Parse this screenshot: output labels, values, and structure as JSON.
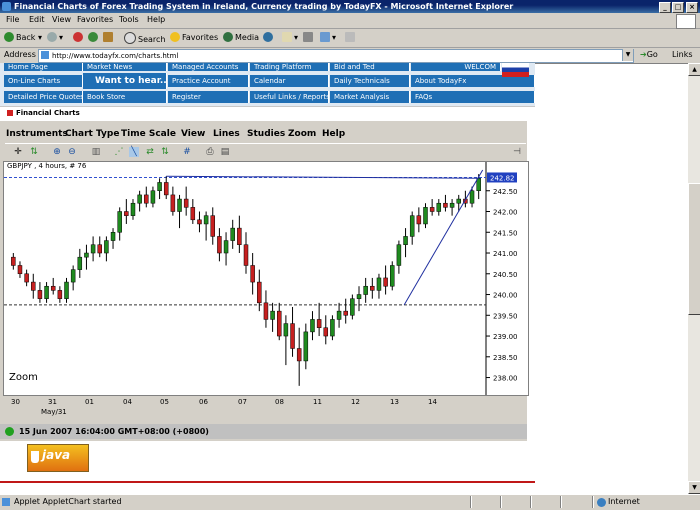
{
  "window": {
    "title": "Financial Charts of Forex Trading System in Ireland, Currency trading by TodayFX - Microsoft Internet Explorer"
  },
  "menubar": [
    "File",
    "Edit",
    "View",
    "Favorites",
    "Tools",
    "Help"
  ],
  "toolbar": {
    "back": "Back",
    "search": "Search",
    "favorites": "Favorites",
    "media": "Media"
  },
  "address": {
    "label": "Address",
    "url": "http://www.todayfx.com/charts.html",
    "go": "Go",
    "links": "Links"
  },
  "nav": {
    "row0": [
      "Home Page",
      "Market News",
      "Managed Accounts",
      "Trading Platform",
      "Bid and Ted",
      "WELCOM"
    ],
    "row1": [
      "On-Line Charts",
      "Want to hear..",
      "Practice Account",
      "Calendar",
      "Daily Technicals",
      "About TodayFx"
    ],
    "row2": [
      "Detailed Price Quotes",
      "Book Store",
      "Register",
      "Useful Links / Reports",
      "Market Analysis",
      "FAQs"
    ]
  },
  "section_title": "Financial Charts",
  "applet": {
    "menu": [
      "Instruments",
      "Chart Type",
      "Time Scale",
      "View",
      "Lines",
      "Studies",
      "Zoom",
      "Help"
    ],
    "symbol_label": "GBPJPY , 4 hours, # 76",
    "zoom_label": "Zoom",
    "status_text": "15 Jun 2007 16:04:00  GMT+08:00 (+0800)"
  },
  "chart_data": {
    "type": "candlestick",
    "symbol": "GBPJPY",
    "interval": "4 hours",
    "x_labels": [
      "30",
      "31",
      "01",
      "04",
      "05",
      "06",
      "07",
      "08",
      "11",
      "12",
      "13",
      "14"
    ],
    "x_sublabel": "May/31",
    "y_ticks": [
      238.0,
      238.5,
      239.0,
      239.5,
      240.0,
      240.5,
      241.0,
      241.5,
      242.0,
      242.5
    ],
    "ylim": [
      237.7,
      243.0
    ],
    "last_price_label": "242.82",
    "reference_lines": [
      242.82,
      239.75
    ],
    "candles": [
      [
        240.9,
        241.0,
        240.6,
        240.7
      ],
      [
        240.7,
        240.8,
        240.4,
        240.5
      ],
      [
        240.5,
        240.6,
        240.2,
        240.3
      ],
      [
        240.3,
        240.5,
        239.9,
        240.1
      ],
      [
        240.1,
        240.3,
        239.8,
        239.9
      ],
      [
        239.9,
        240.3,
        239.8,
        240.2
      ],
      [
        240.2,
        240.4,
        240.0,
        240.1
      ],
      [
        240.1,
        240.2,
        239.8,
        239.9
      ],
      [
        239.9,
        240.4,
        239.8,
        240.3
      ],
      [
        240.3,
        240.7,
        240.1,
        240.6
      ],
      [
        240.6,
        241.1,
        240.4,
        240.9
      ],
      [
        240.9,
        241.2,
        240.6,
        241.0
      ],
      [
        241.0,
        241.4,
        240.8,
        241.2
      ],
      [
        241.2,
        241.4,
        240.9,
        241.0
      ],
      [
        241.0,
        241.4,
        240.8,
        241.3
      ],
      [
        241.3,
        241.6,
        241.1,
        241.5
      ],
      [
        241.5,
        242.1,
        241.3,
        242.0
      ],
      [
        242.0,
        242.3,
        241.7,
        241.9
      ],
      [
        241.9,
        242.3,
        241.8,
        242.2
      ],
      [
        242.2,
        242.5,
        242.0,
        242.4
      ],
      [
        242.4,
        242.6,
        242.1,
        242.2
      ],
      [
        242.2,
        242.6,
        242.1,
        242.5
      ],
      [
        242.5,
        242.8,
        242.3,
        242.7
      ],
      [
        242.7,
        242.85,
        242.3,
        242.4
      ],
      [
        242.4,
        242.6,
        241.9,
        242.0
      ],
      [
        242.0,
        242.4,
        241.6,
        242.3
      ],
      [
        242.3,
        242.6,
        241.9,
        242.1
      ],
      [
        242.1,
        242.3,
        241.7,
        241.8
      ],
      [
        241.8,
        242.0,
        241.5,
        241.7
      ],
      [
        241.7,
        242.0,
        241.3,
        241.9
      ],
      [
        241.9,
        242.1,
        241.2,
        241.4
      ],
      [
        241.4,
        241.6,
        240.8,
        241.0
      ],
      [
        241.0,
        241.5,
        240.7,
        241.3
      ],
      [
        241.3,
        241.8,
        241.1,
        241.6
      ],
      [
        241.6,
        241.9,
        241.0,
        241.2
      ],
      [
        241.2,
        241.5,
        240.5,
        240.7
      ],
      [
        240.7,
        241.0,
        240.0,
        240.3
      ],
      [
        240.3,
        240.6,
        239.6,
        239.8
      ],
      [
        239.8,
        240.1,
        239.2,
        239.4
      ],
      [
        239.4,
        239.8,
        239.1,
        239.6
      ],
      [
        239.6,
        239.8,
        238.9,
        239.0
      ],
      [
        239.0,
        239.5,
        238.3,
        239.3
      ],
      [
        239.3,
        239.7,
        238.5,
        238.7
      ],
      [
        238.7,
        239.2,
        237.8,
        238.4
      ],
      [
        238.4,
        239.3,
        238.2,
        239.1
      ],
      [
        239.1,
        239.6,
        238.9,
        239.4
      ],
      [
        239.4,
        239.8,
        239.0,
        239.2
      ],
      [
        239.2,
        239.5,
        238.8,
        239.0
      ],
      [
        239.0,
        239.5,
        238.9,
        239.4
      ],
      [
        239.4,
        239.8,
        239.2,
        239.6
      ],
      [
        239.6,
        239.9,
        239.3,
        239.5
      ],
      [
        239.5,
        240.0,
        239.4,
        239.9
      ],
      [
        239.9,
        240.2,
        239.6,
        240.0
      ],
      [
        240.0,
        240.4,
        239.8,
        240.2
      ],
      [
        240.2,
        240.4,
        239.9,
        240.1
      ],
      [
        240.1,
        240.5,
        239.9,
        240.4
      ],
      [
        240.4,
        240.7,
        240.0,
        240.2
      ],
      [
        240.2,
        240.8,
        240.1,
        240.7
      ],
      [
        240.7,
        241.3,
        240.5,
        241.2
      ],
      [
        241.2,
        241.6,
        240.9,
        241.4
      ],
      [
        241.4,
        242.0,
        241.2,
        241.9
      ],
      [
        241.9,
        242.1,
        241.5,
        241.7
      ],
      [
        241.7,
        242.2,
        241.6,
        242.1
      ],
      [
        242.1,
        242.3,
        241.9,
        242.0
      ],
      [
        242.0,
        242.3,
        241.9,
        242.2
      ],
      [
        242.2,
        242.4,
        242.0,
        242.1
      ],
      [
        242.1,
        242.3,
        241.9,
        242.2
      ],
      [
        242.2,
        242.4,
        242.0,
        242.3
      ],
      [
        242.3,
        242.5,
        242.1,
        242.2
      ],
      [
        242.2,
        242.6,
        242.1,
        242.5
      ],
      [
        242.5,
        242.9,
        242.3,
        242.8
      ]
    ]
  },
  "java_badge": "java",
  "statusbar": {
    "text": "Applet AppletChart started",
    "zone": "Internet"
  }
}
